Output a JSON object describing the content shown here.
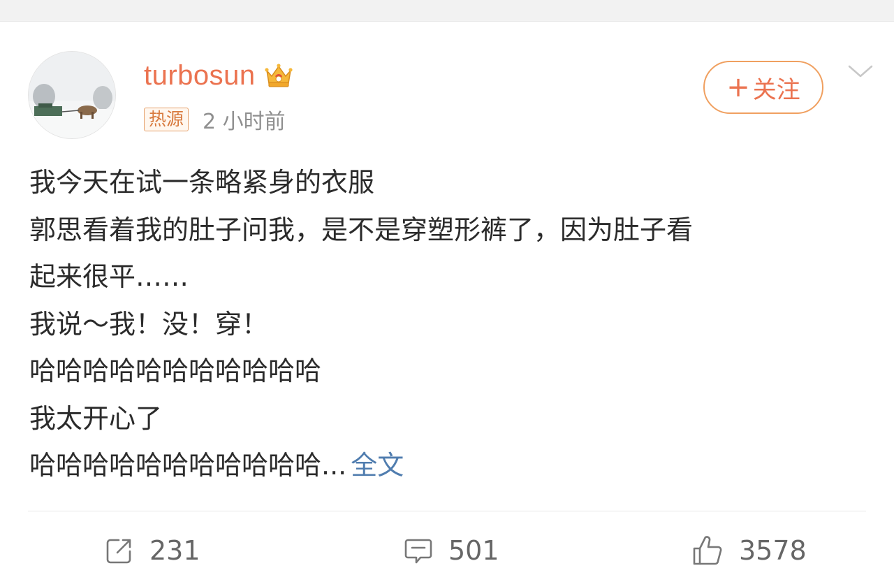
{
  "post": {
    "username": "turbosun",
    "source_badge": "热源",
    "timestamp": "2 小时前",
    "follow_label": "关注",
    "content_lines": [
      "我今天在试一条略紧身的衣服",
      "郭思看着我的肚子问我，是不是穿塑形裤了，因为肚子看",
      "起来很平……",
      "我说～我！没！穿！",
      "哈哈哈哈哈哈哈哈哈哈哈",
      "我太开心了",
      "哈哈哈哈哈哈哈哈哈哈哈..."
    ],
    "full_text_link": "全文"
  },
  "actions": {
    "repost_count": "231",
    "comment_count": "501",
    "like_count": "3578"
  },
  "icons": {
    "verified": "crown-icon",
    "more": "chevron-down-icon",
    "repost": "repost-icon",
    "comment": "comment-icon",
    "like": "thumbs-up-icon"
  },
  "colors": {
    "username": "#eb7350",
    "follow_border": "#f0a060",
    "link": "#507daf",
    "timestamp": "#8f8f8f"
  }
}
